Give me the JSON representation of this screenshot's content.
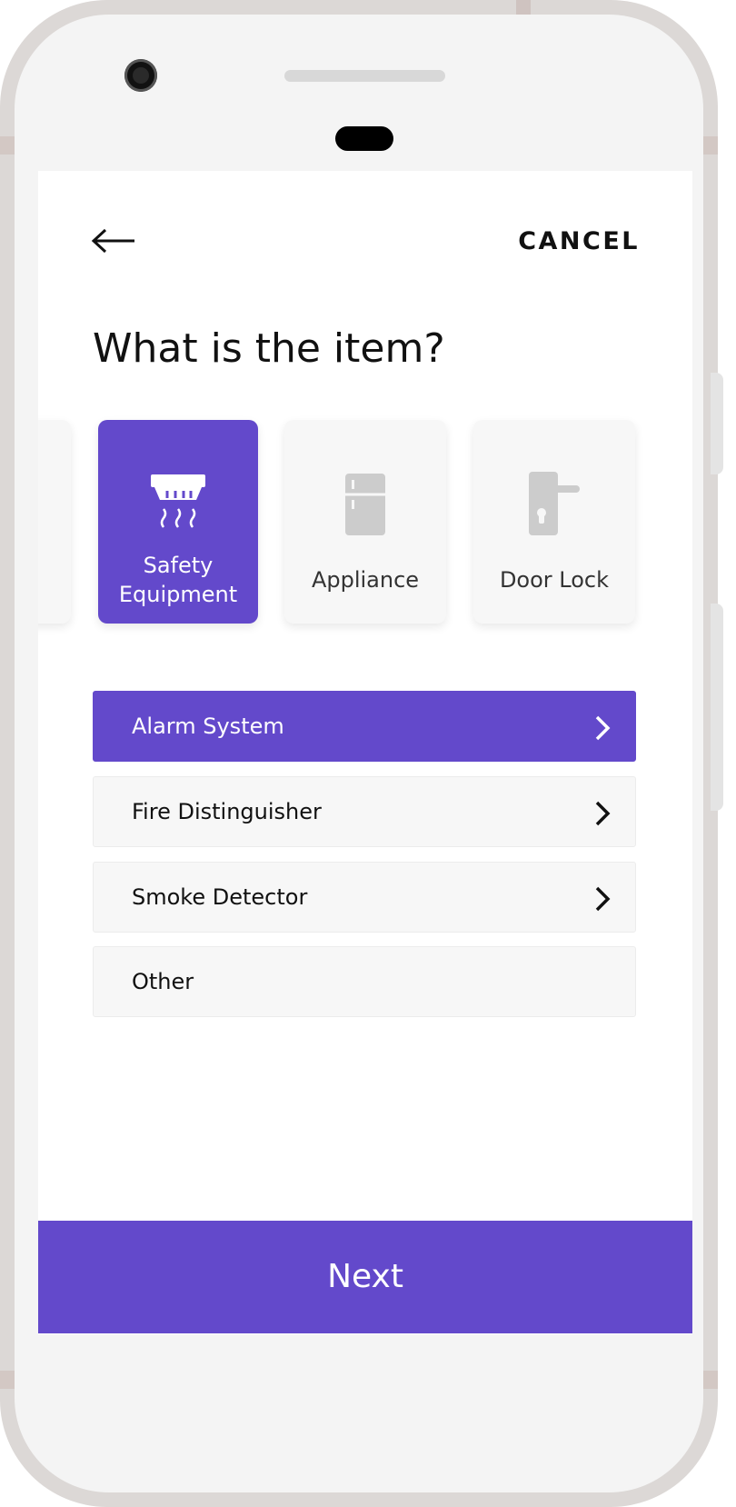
{
  "header": {
    "cancel_label": "CANCEL"
  },
  "page": {
    "title": "What is the item?"
  },
  "categories": [
    {
      "label": "",
      "icon": "partial-hidden-card",
      "selected": false
    },
    {
      "label_line1": "Safety",
      "label_line2": "Equipment",
      "icon": "smoke-detector-icon",
      "selected": true
    },
    {
      "label": "Appliance",
      "icon": "fridge-icon",
      "selected": false
    },
    {
      "label": "Door Lock",
      "icon": "door-handle-icon",
      "selected": false
    }
  ],
  "items": [
    {
      "label": "Alarm System",
      "active": true,
      "has_chevron": true
    },
    {
      "label": "Fire Distinguisher",
      "active": false,
      "has_chevron": true
    },
    {
      "label": "Smoke Detector",
      "active": false,
      "has_chevron": true
    },
    {
      "label": "Other",
      "active": false,
      "has_chevron": false
    }
  ],
  "footer": {
    "next_label": "Next"
  },
  "colors": {
    "accent": "#6349cb",
    "card_bg": "#f7f7f7",
    "icon_gray": "#cccccc"
  }
}
